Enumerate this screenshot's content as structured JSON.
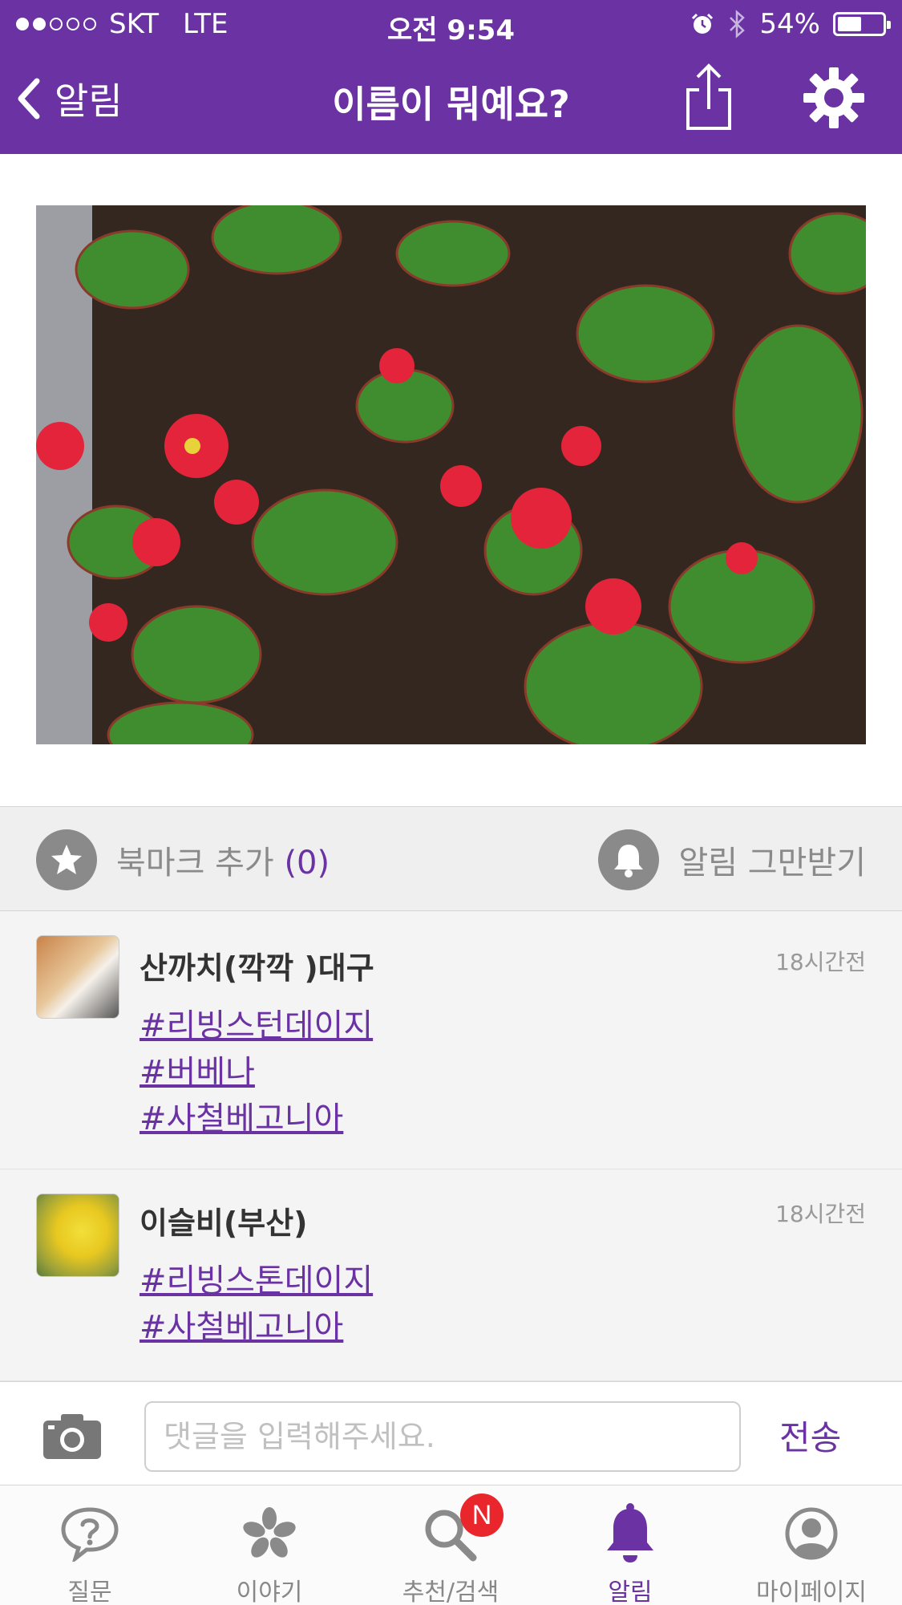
{
  "status": {
    "carrier": "SKT",
    "network": "LTE",
    "time": "오전 9:54",
    "battery": "54%",
    "battery_level": 0.54,
    "signal_bars": 2
  },
  "nav": {
    "back_label": "알림",
    "title": "이름이 뭐예요?"
  },
  "actions": {
    "bookmark_label": "북마크 추가",
    "bookmark_count": "(0)",
    "unsubscribe_label": "알림 그만받기"
  },
  "comments": [
    {
      "author": "산까치(깍깍 )대구",
      "time": "18시간전",
      "tags": [
        "#리빙스턴데이지",
        "#버베나",
        "#사철베고니아"
      ]
    },
    {
      "author": "이슬비(부산)",
      "time": "18시간전",
      "tags": [
        "#리빙스톤데이지",
        "#사철베고니아"
      ]
    }
  ],
  "input": {
    "placeholder": "댓글을 입력해주세요.",
    "send_label": "전송"
  },
  "tabs": [
    {
      "label": "질문",
      "icon": "question-bubble-icon"
    },
    {
      "label": "이야기",
      "icon": "flower-icon"
    },
    {
      "label": "추천/검색",
      "icon": "search-icon",
      "badge": "N"
    },
    {
      "label": "알림",
      "icon": "bell-icon",
      "active": true
    },
    {
      "label": "마이페이지",
      "icon": "profile-icon"
    }
  ],
  "colors": {
    "brand": "#6a32a2",
    "badge": "#e8262b"
  }
}
